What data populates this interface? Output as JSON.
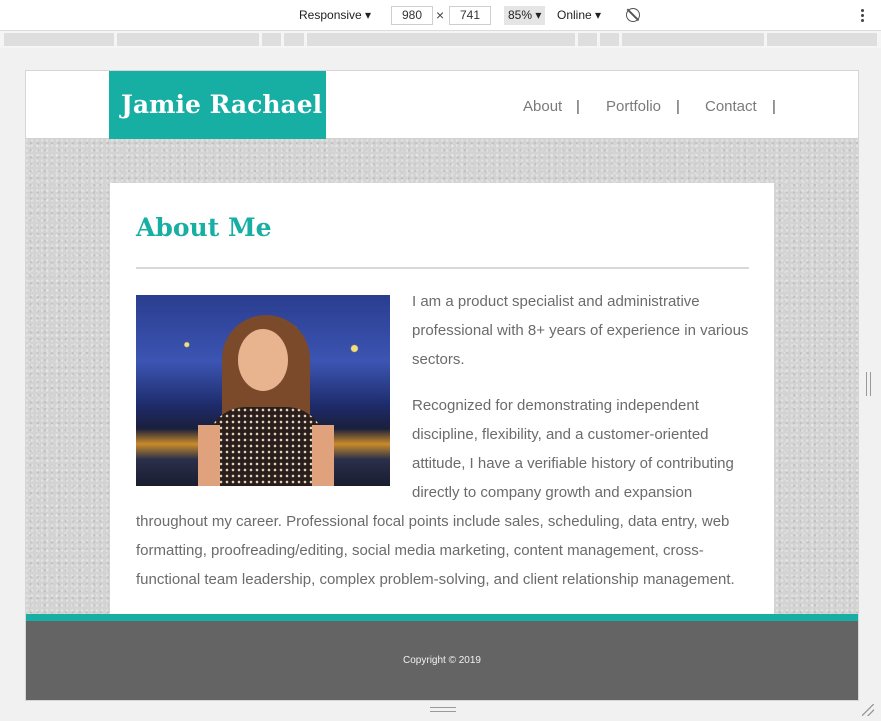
{
  "devtools": {
    "device": "Responsive ▾",
    "width": "980",
    "times": "×",
    "height": "741",
    "zoom": "85% ▾",
    "network": "Online ▾"
  },
  "site": {
    "brand": "Jamie Rachael",
    "nav": [
      {
        "label": "About"
      },
      {
        "label": "Portfolio"
      },
      {
        "label": "Contact"
      }
    ],
    "nav_separator": "|",
    "accent_color": "#17aea4"
  },
  "about": {
    "title": "About Me",
    "paragraphs": [
      "I am a product specialist and administrative professional with 8+ years of experience in various sectors.",
      "Recognized for demonstrating independent discipline, flexibility, and a customer-oriented attitude, I have a verifiable history of contributing directly to company growth and expansion throughout my career. Professional focal points include sales, scheduling, data entry, web formatting, proofreading/editing, social media marketing, content management, cross-functional team leadership, complex problem-solving, and client relationship management."
    ]
  },
  "footer": {
    "copyright": "Copyright © 2019"
  }
}
